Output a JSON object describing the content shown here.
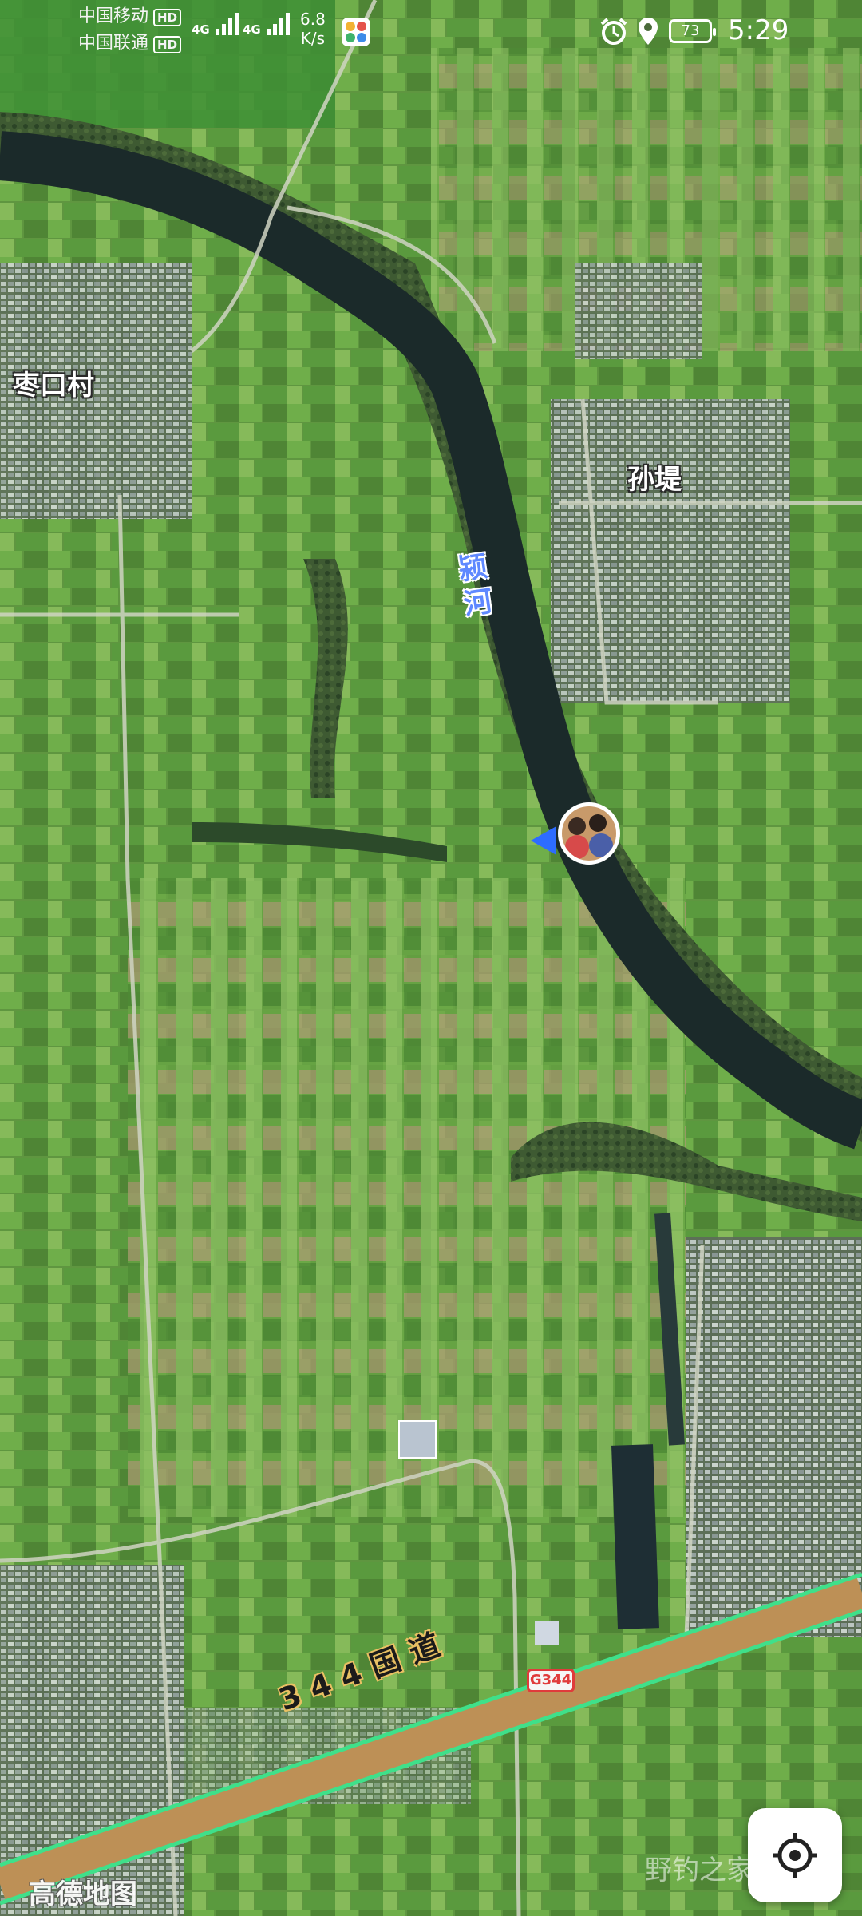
{
  "status_bar": {
    "carrier1": "中国移动",
    "carrier2": "中国联通",
    "hd": "HD",
    "network1": "4G",
    "network2": "4G",
    "speed_value": "6.8",
    "speed_unit": "K/s",
    "battery": "73",
    "time": "5:29"
  },
  "map": {
    "labels": {
      "village_west": "枣口村",
      "village_east": "孙堤",
      "river": "颍河",
      "road": "344国道",
      "road_shield": "G344"
    },
    "brand": "高德地图",
    "watermark": "野钓之家"
  },
  "icons": {
    "alarm": "alarm-icon",
    "location": "location-pin-icon",
    "locate": "crosshair-icon",
    "avatar": "user-avatar"
  },
  "colors": {
    "river": "#1b2a2a",
    "field_green": "#5f9640",
    "road_highlight": "#3fe08a",
    "location_blue": "#2d6cff",
    "shield_red": "#e03b3b"
  }
}
